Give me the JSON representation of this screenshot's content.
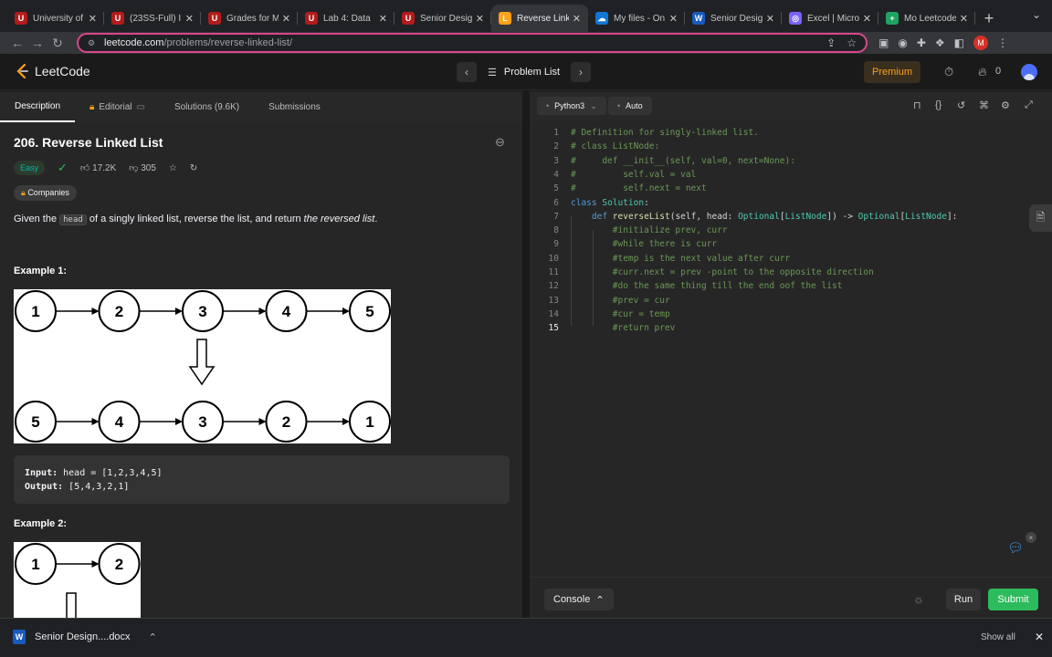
{
  "browser": {
    "tabs": [
      {
        "title": "University of",
        "fav_color": "#b31b1b",
        "fav_text": "U"
      },
      {
        "title": "(23SS-Full) I",
        "fav_color": "#b31b1b",
        "fav_text": "U"
      },
      {
        "title": "Grades for M",
        "fav_color": "#b31b1b",
        "fav_text": "U"
      },
      {
        "title": "Lab 4: Data",
        "fav_color": "#b31b1b",
        "fav_text": "U"
      },
      {
        "title": "Senior Desig",
        "fav_color": "#b31b1b",
        "fav_text": "U"
      },
      {
        "title": "Reverse Link",
        "fav_color": "#ffa116",
        "fav_text": "L",
        "active": true
      },
      {
        "title": "My files - On",
        "fav_color": "#0f78d4",
        "fav_text": "☁"
      },
      {
        "title": "Senior Desig",
        "fav_color": "#185abd",
        "fav_text": "W"
      },
      {
        "title": "Excel | Micro",
        "fav_color": "#7b61ff",
        "fav_text": "◎"
      },
      {
        "title": "Mo Leetcode",
        "fav_color": "#1ea362",
        "fav_text": "+"
      }
    ],
    "url_host": "leetcode.com",
    "url_path": "/problems/reverse-linked-list/",
    "profile_letter": "M"
  },
  "header": {
    "logo": "LeetCode",
    "problem_list": "Problem List",
    "premium": "Premium",
    "streak": "0"
  },
  "left_tabs": [
    "Description",
    "Editorial",
    "Solutions (9.6K)",
    "Submissions"
  ],
  "problem": {
    "title": "206. Reverse Linked List",
    "difficulty": "Easy",
    "likes": "17.2K",
    "dislikes": "305",
    "companies": "Companies",
    "desc_pre": "Given the ",
    "desc_code": "head",
    "desc_mid": " of a singly linked list, reverse the list, and return ",
    "desc_em": "the reversed list",
    "desc_end": ".",
    "example1_label": "Example 1:",
    "example2_label": "Example 2:",
    "ex1_top": [
      "1",
      "2",
      "3",
      "4",
      "5"
    ],
    "ex1_bottom": [
      "5",
      "4",
      "3",
      "2",
      "1"
    ],
    "ex2_top": [
      "1",
      "2"
    ],
    "input_label": "Input:",
    "input_value": " head = [1,2,3,4,5]",
    "output_label": "Output:",
    "output_value": " [5,4,3,2,1]"
  },
  "editor": {
    "language": "Python3",
    "auto": "Auto",
    "lines": [
      {
        "n": "1",
        "code": "# Definition for singly-linked list."
      },
      {
        "n": "2",
        "code": "# class ListNode:"
      },
      {
        "n": "3",
        "code": "#     def __init__(self, val=0, next=None):"
      },
      {
        "n": "4",
        "code": "#         self.val = val"
      },
      {
        "n": "5",
        "code": "#         self.next = next"
      },
      {
        "n": "6",
        "code": "class Solution:"
      },
      {
        "n": "7",
        "code": "    def reverseList(self, head: Optional[ListNode]) -> Optional[ListNode]:"
      },
      {
        "n": "8",
        "code": "        #initialize prev, curr"
      },
      {
        "n": "9",
        "code": "        #while there is curr"
      },
      {
        "n": "10",
        "code": "        #temp is the next value after curr"
      },
      {
        "n": "11",
        "code": "        #curr.next = prev -point to the opposite direction"
      },
      {
        "n": "12",
        "code": "        #do the same thing till the end oof the list"
      },
      {
        "n": "13",
        "code": "        #prev = cur"
      },
      {
        "n": "14",
        "code": "        #cur = temp"
      },
      {
        "n": "15",
        "code": "        #return prev"
      }
    ],
    "console": "Console",
    "run": "Run",
    "submit": "Submit"
  },
  "downloads": {
    "file": "Senior Design....docx",
    "show_all": "Show all"
  },
  "colors": {
    "accent": "#ffa116",
    "submit": "#2cbb5d",
    "easy": "#00b8a3"
  }
}
